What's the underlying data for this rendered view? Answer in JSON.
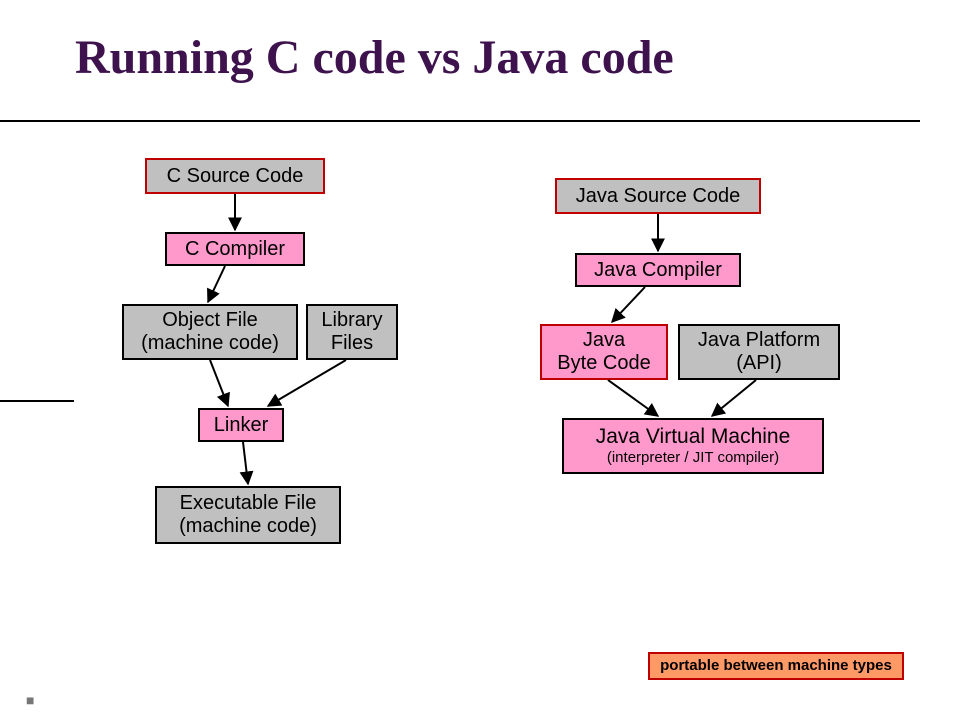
{
  "title": "Running C code vs Java code",
  "c": {
    "source": "C Source Code",
    "compiler": "C Compiler",
    "object1": "Object File",
    "object2": "(machine code)",
    "library1": "Library",
    "library2": "Files",
    "linker": "Linker",
    "exec1": "Executable File",
    "exec2": "(machine code)"
  },
  "java": {
    "source": "Java Source Code",
    "compiler": "Java Compiler",
    "byte1": "Java",
    "byte2": "Byte Code",
    "api1": "Java Platform",
    "api2": "(API)",
    "jvm1": "Java Virtual Machine",
    "jvm2": "(interpreter / JIT compiler)"
  },
  "note": "portable between machine types",
  "colors": {
    "gray": "#c0c0c0",
    "pink": "#ff99cc",
    "red": "#c00000",
    "orange": "#ff9966",
    "titleColor": "#3d124d"
  }
}
